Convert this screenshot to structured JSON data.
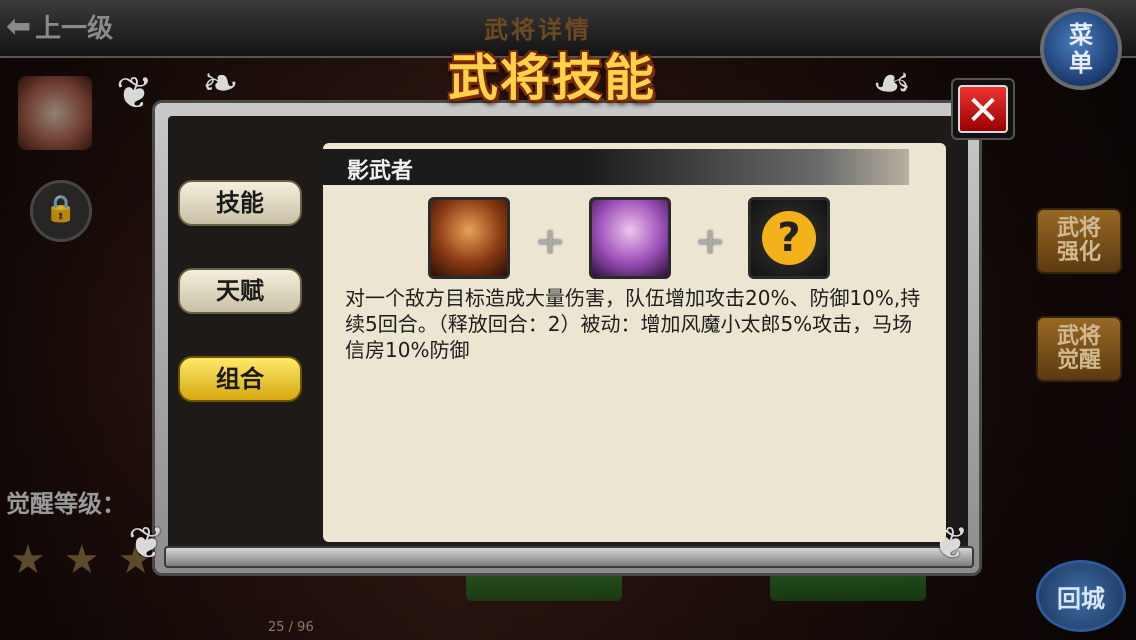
{
  "header": {
    "back_label": "上一级",
    "bg_title": "武将详情",
    "menu_label_1": "菜",
    "menu_label_2": "单"
  },
  "side": {
    "awaken_label": "觉醒等级：",
    "page_counter": "25 / 96"
  },
  "right_buttons": [
    {
      "line1": "武将",
      "line2": "强化"
    },
    {
      "line1": "武将",
      "line2": "觉醒"
    }
  ],
  "city_label": "回城",
  "dialog": {
    "title": "武将技能",
    "close_symbol": "✕",
    "tabs": [
      {
        "label": "技能",
        "active": false
      },
      {
        "label": "天赋",
        "active": false
      },
      {
        "label": "组合",
        "active": true
      }
    ],
    "combo_name": "影武者",
    "plus_symbol": "+",
    "unknown_symbol": "?",
    "description": "对一个敌方目标造成大量伤害，队伍增加攻击20%、防御10%,持续5回合。（释放回合：2）被动：增加风魔小太郎5%攻击，马场信房10%防御"
  },
  "colors": {
    "title_gold": "#ffd24a",
    "tab_active": "#ffe86b",
    "panel_bg": "#ece5d1",
    "close_red": "#e33"
  },
  "icons": {
    "back": "back-arrow-icon",
    "lock": "lock-icon",
    "star": "star-icon",
    "unknown": "question-head-icon"
  }
}
